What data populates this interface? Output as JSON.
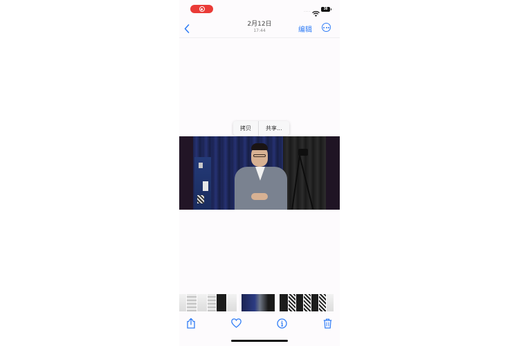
{
  "status_bar": {
    "recording": true,
    "signal_text": "....",
    "battery": "38"
  },
  "nav": {
    "date": "2月12日",
    "time": "17:44",
    "edit_label": "编辑",
    "back_icon": "chevron-left-icon",
    "more_icon": "ellipsis-circle-icon"
  },
  "context_menu": {
    "items": [
      {
        "label": "拷贝"
      },
      {
        "label": "共享..."
      }
    ]
  },
  "photo": {
    "description_icon": "video-frame"
  },
  "thumbnails": {
    "selected_index": 4
  },
  "toolbar": {
    "share_icon": "share-icon",
    "favorite_icon": "heart-icon",
    "info_icon": "info-icon",
    "delete_icon": "trash-icon"
  },
  "colors": {
    "accent": "#2f7cf6",
    "recording": "#ea3b37"
  }
}
